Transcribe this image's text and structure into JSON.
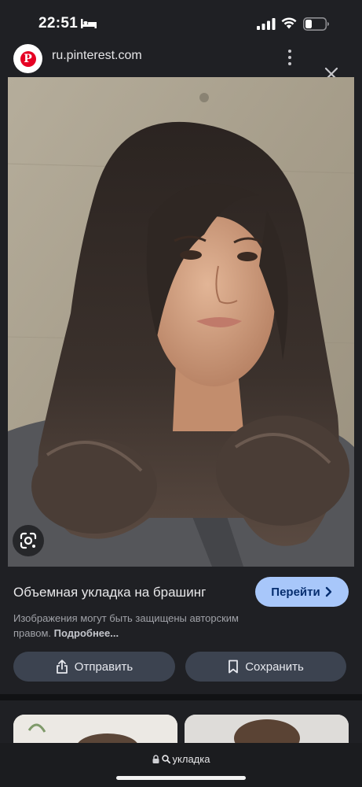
{
  "status_bar": {
    "time": "22:51"
  },
  "header": {
    "site_url": "ru.pinterest.com"
  },
  "image": {
    "alt": ""
  },
  "info": {
    "title": "Объемная укладка на брашинг",
    "go_label": "Перейти",
    "copyright_text": "Изображения могут быть защищены авторским правом.",
    "copyright_more": "Подробнее...",
    "share_label": "Отправить",
    "save_label": "Сохранить"
  },
  "bottom_bar": {
    "url_text": "укладка"
  },
  "colors": {
    "accent": "#a8c7fa",
    "background": "#1f2024",
    "button_bg": "#3c4350",
    "pinterest_red": "#e60023"
  }
}
